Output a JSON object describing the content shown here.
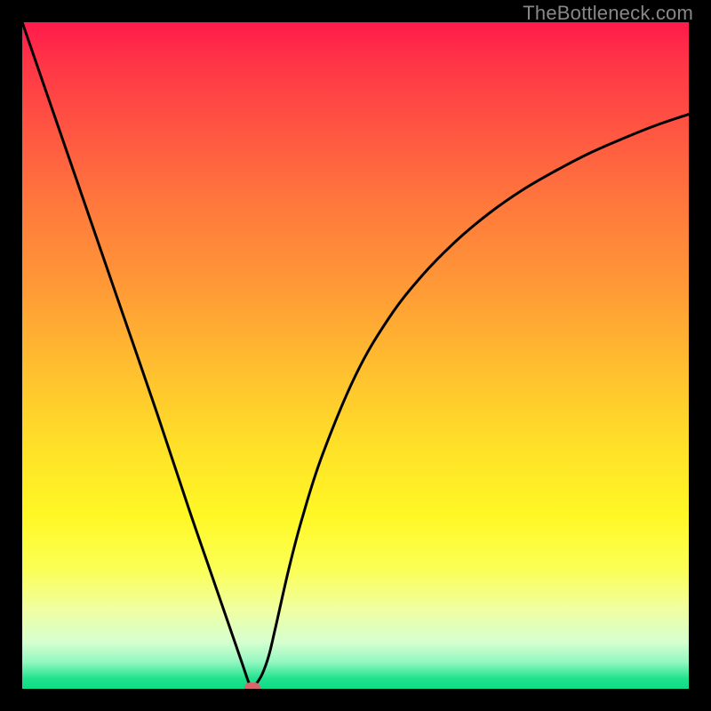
{
  "watermark": "TheBottleneck.com",
  "chart_data": {
    "type": "line",
    "title": "",
    "xlabel": "",
    "ylabel": "",
    "xlim": [
      0,
      100
    ],
    "ylim": [
      0,
      100
    ],
    "grid": false,
    "legend": false,
    "series": [
      {
        "name": "curve",
        "x": [
          0,
          5,
          10,
          15,
          20,
          25,
          28,
          30,
          32,
          33,
          34,
          34.5,
          35,
          36,
          37,
          38,
          40,
          42,
          45,
          50,
          55,
          60,
          65,
          70,
          75,
          80,
          85,
          90,
          95,
          100
        ],
        "y": [
          100,
          85.5,
          71,
          56.5,
          42,
          27,
          18.3,
          12.5,
          6.7,
          3.8,
          0.9,
          0.3,
          0.6,
          2.2,
          5.0,
          9.2,
          18.0,
          25.6,
          35.0,
          47.0,
          55.6,
          62.0,
          67.1,
          71.3,
          74.8,
          77.7,
          80.3,
          82.5,
          84.5,
          86.2
        ]
      }
    ],
    "marker": {
      "x": 34.5,
      "y": 0.2
    },
    "background_gradient": {
      "top": "#ff1a4b",
      "mid": "#ffe128",
      "bottom": "#0fdc85"
    }
  }
}
